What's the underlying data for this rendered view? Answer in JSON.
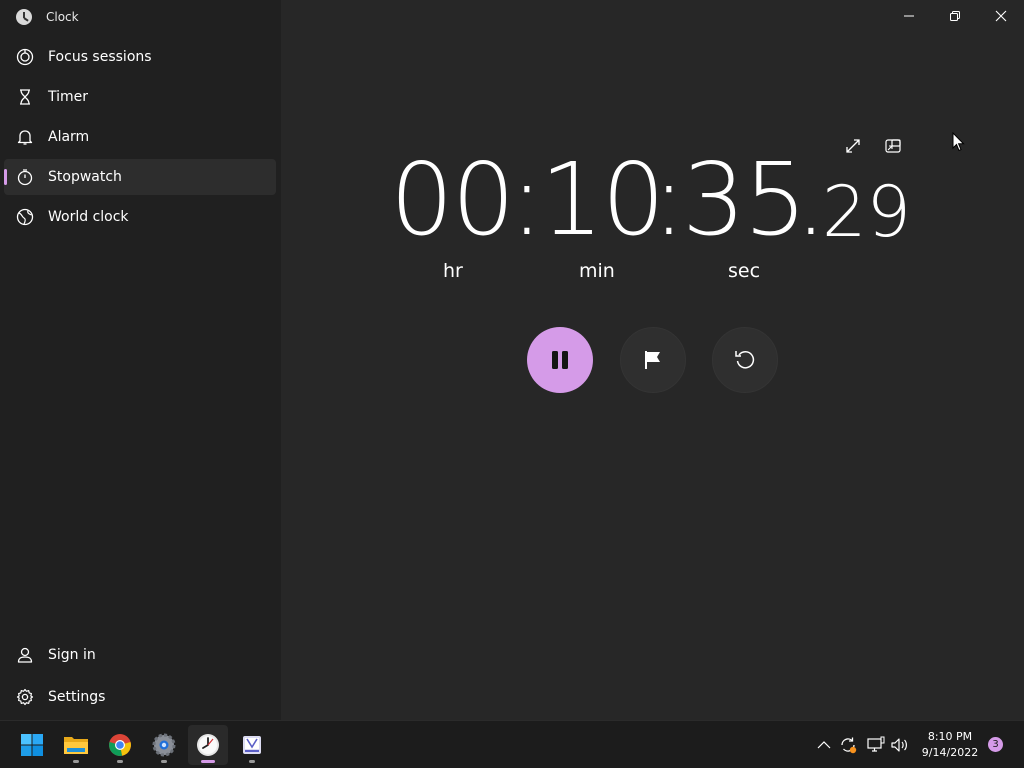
{
  "app": {
    "title": "Clock"
  },
  "sidebar": {
    "items": [
      {
        "label": "Focus sessions",
        "icon": "focus-icon"
      },
      {
        "label": "Timer",
        "icon": "hourglass-icon"
      },
      {
        "label": "Alarm",
        "icon": "bell-icon"
      },
      {
        "label": "Stopwatch",
        "icon": "stopwatch-icon",
        "active": true
      },
      {
        "label": "World clock",
        "icon": "globe-icon"
      }
    ],
    "bottom": [
      {
        "label": "Sign in",
        "icon": "person-icon"
      },
      {
        "label": "Settings",
        "icon": "gear-icon"
      }
    ]
  },
  "stopwatch": {
    "hours": "00",
    "minutes": "10",
    "seconds": "35",
    "hundredths": "29",
    "sep1": ":",
    "sep2": ":",
    "dot": ".",
    "unit_hr": "hr",
    "unit_min": "min",
    "unit_sec": "sec",
    "running": true
  },
  "taskbar": {
    "apps": [
      "start-icon",
      "file-explorer-icon",
      "chrome-icon",
      "settings-icon",
      "clock-icon",
      "snipping-tool-icon"
    ],
    "active_app": "clock-icon",
    "time": "8:10 PM",
    "date": "9/14/2022",
    "notification_count": "3"
  },
  "colors": {
    "accent": "#d59be8",
    "background": "#272727",
    "sidebar": "#202020"
  }
}
